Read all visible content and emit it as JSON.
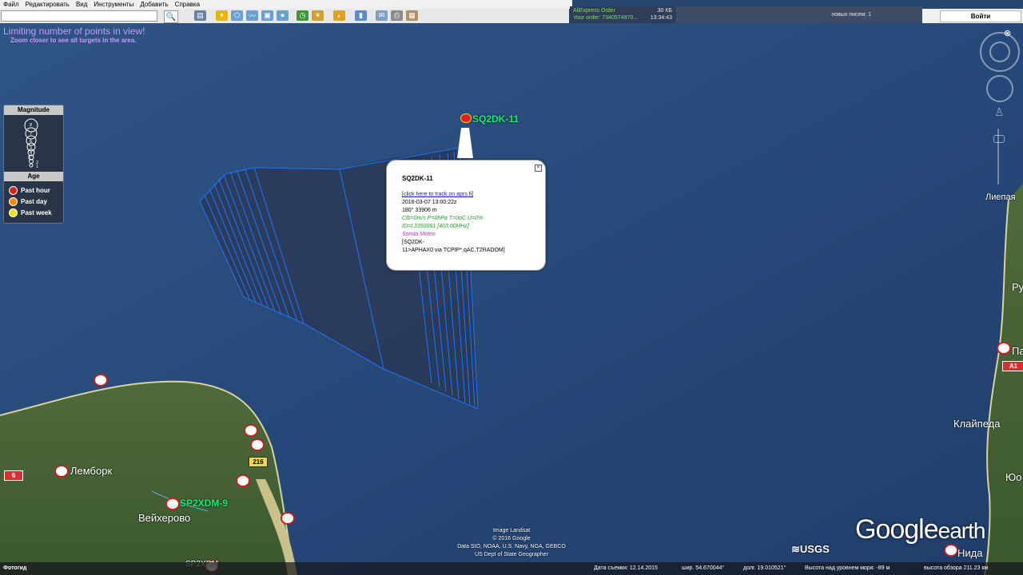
{
  "menu": [
    "Файл",
    "Редактировать",
    "Вид",
    "Инструменты",
    "Добавить",
    "Справка"
  ],
  "notification": {
    "line1": "AliExpress Order",
    "line2": "Your order: 7340574970...",
    "size": "30 КБ",
    "time": "13:34:43"
  },
  "mail": {
    "text": "новых писем: 1"
  },
  "login": {
    "label": "Войти"
  },
  "map": {
    "limit_title": "Limiting number of points in view!",
    "limit_sub": "Zoom closer to see all targets in the area.",
    "legend": {
      "magnitude_title": "Magnitude",
      "magnitudes": [
        "8",
        "7",
        "6",
        "5",
        "4",
        "3",
        "2",
        "1"
      ],
      "age_title": "Age",
      "items": [
        {
          "label": "Past hour",
          "color": "#e02020"
        },
        {
          "label": "Past day",
          "color": "#ff8c00"
        },
        {
          "label": "Past week",
          "color": "#f0e020"
        }
      ]
    },
    "stations": {
      "sq2dk": "SQ2DK-11",
      "sp2xdm9": "SP2XDM-9",
      "sp2xdm": "SP2XDM"
    },
    "places": {
      "lebork": "Лемборк",
      "wejherowo": "Вейхерово",
      "liepaja": "Лиепая",
      "klaipeda": "Клайпеда",
      "nida": "Нида",
      "ru_partial": "Ру",
      "pa_partial": "Па",
      "yu_partial": "Юо"
    },
    "roads": {
      "r216": "216",
      "r6": "6",
      "a1": "A1"
    },
    "balloon": {
      "title": "SQ2DK-11",
      "link": "[click here to track on aprs.fi]",
      "datetime": "2016-03-07 13:00:22z",
      "course": "180° 33906 m",
      "sensor": "Clb=0m/s P=0hPa T=0oC U=0%",
      "id": "ID=L3350091 [403.00MHz]",
      "type": "Sonda Meteo",
      "path1": "[SQ2DK-",
      "path2": "11>APHAX0 via TCPIP*,qAC,T2RADOM]"
    },
    "attribution": [
      "Image Landsat",
      "© 2016 Google",
      "Data SIO, NOAA, U.S. Navy, NGA, GEBCO",
      "US Dept of State Geographer"
    ],
    "brand_google": "Google",
    "brand_earth": "earth",
    "usgs": "≋USGS",
    "photo_label": "Фотогид"
  },
  "status": {
    "date_label": "Дата съемки: 12.14.2015",
    "lat": "шир.   54.670044°",
    "lon": "долг.   19.010521°",
    "elev": "Высота над уровнем моря:   -89 м",
    "eye": "высота обзора 211.23 км"
  }
}
